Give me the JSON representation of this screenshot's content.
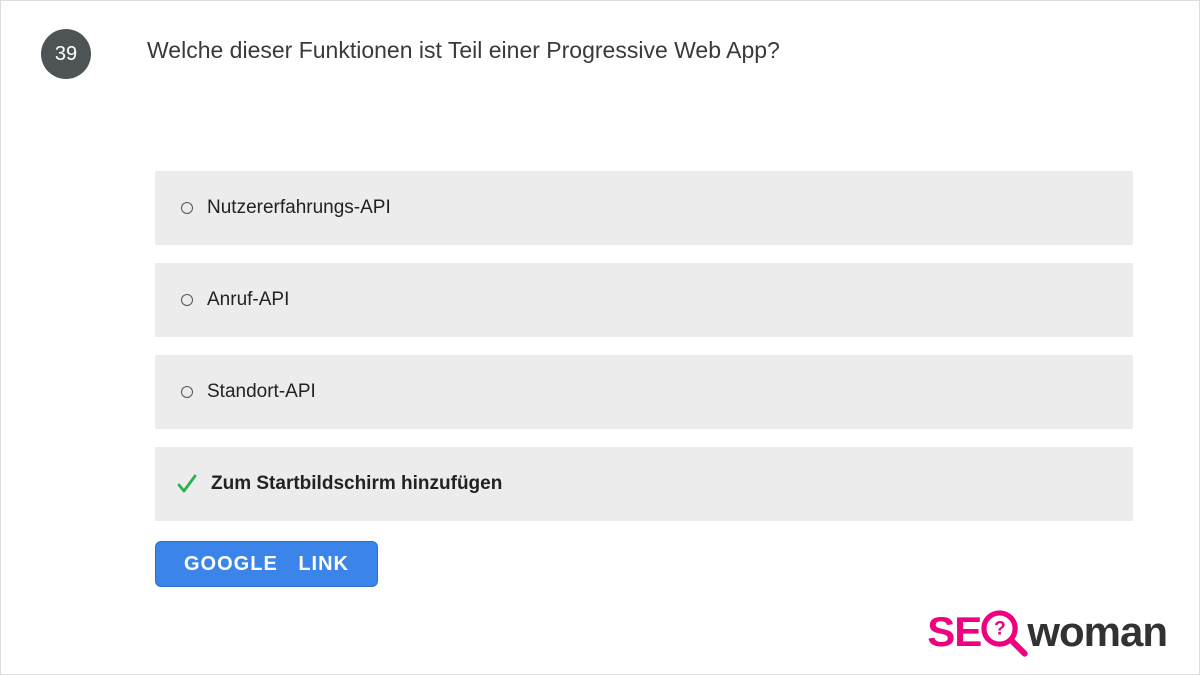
{
  "question_number": "39",
  "question_text": "Welche dieser Funktionen ist Teil einer Progressive Web App?",
  "options": [
    {
      "label": "Nutzererfahrungs-API",
      "correct": false
    },
    {
      "label": "Anruf-API",
      "correct": false
    },
    {
      "label": "Standort-API",
      "correct": false
    },
    {
      "label": "Zum Startbildschirm hinzufügen",
      "correct": true
    }
  ],
  "button_label": "GOOGLE LINK",
  "logo": {
    "part1": "SE",
    "part2": "woman"
  }
}
